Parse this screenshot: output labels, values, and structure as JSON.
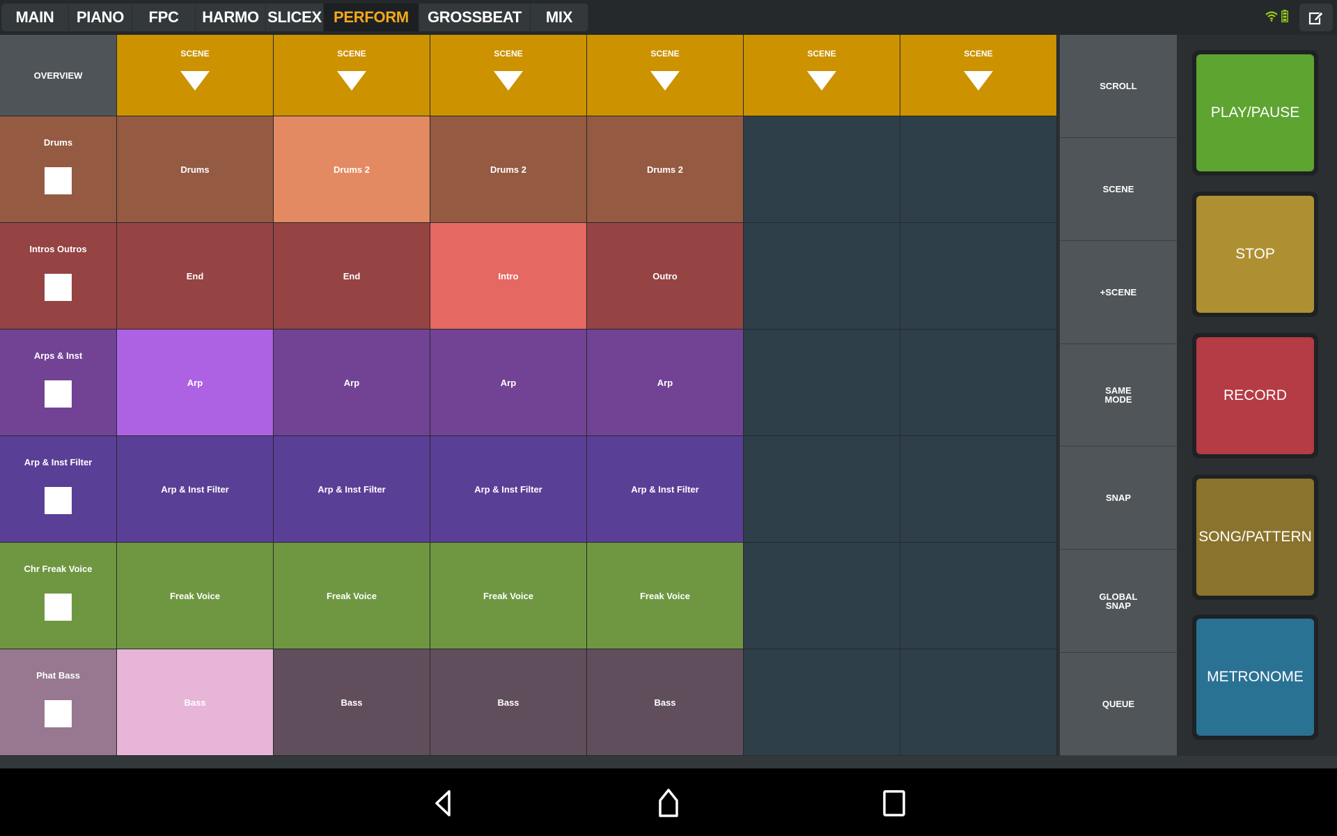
{
  "tabs": [
    {
      "label": "MAIN",
      "active": false
    },
    {
      "label": "PIANO",
      "active": false
    },
    {
      "label": "FPC",
      "active": false
    },
    {
      "label": "HARMO",
      "active": false
    },
    {
      "label": "SLICEX",
      "active": false
    },
    {
      "label": "PERFORM",
      "active": true
    },
    {
      "label": "GROSSBEAT",
      "active": false
    },
    {
      "label": "MIX",
      "active": false
    }
  ],
  "status": {
    "wifi_icon": "wifi-icon",
    "battery_icon": "battery-icon",
    "accent": "#9ccc1a"
  },
  "edit_icon": "edit-icon",
  "grid": {
    "overview_label": "OVERVIEW",
    "scene_label": "SCENE",
    "scene_count": 6,
    "tracks": [
      {
        "name": "Drums",
        "color": "#955a42",
        "active_color": "#e38a62",
        "clips": [
          {
            "label": "Drums",
            "active": false
          },
          {
            "label": "Drums 2",
            "active": true
          },
          {
            "label": "Drums 2",
            "active": false
          },
          {
            "label": "Drums 2",
            "active": false
          }
        ]
      },
      {
        "name": "Intros Outros",
        "color": "#954343",
        "active_color": "#e56862",
        "clips": [
          {
            "label": "End",
            "active": false
          },
          {
            "label": "End",
            "active": false
          },
          {
            "label": "Intro",
            "active": true
          },
          {
            "label": "Outro",
            "active": false
          }
        ]
      },
      {
        "name": "Arps & Inst",
        "color": "#724395",
        "active_color": "#ad62e3",
        "clips": [
          {
            "label": "Arp",
            "active": true
          },
          {
            "label": "Arp",
            "active": false
          },
          {
            "label": "Arp",
            "active": false
          },
          {
            "label": "Arp",
            "active": false
          }
        ]
      },
      {
        "name": "Arp & Inst Filter",
        "color": "#5a3f96",
        "active_color": "#7b5dd0",
        "clips": [
          {
            "label": "Arp & Inst Filter",
            "active": false
          },
          {
            "label": "Arp & Inst Filter",
            "active": false
          },
          {
            "label": "Arp & Inst Filter",
            "active": false
          },
          {
            "label": "Arp & Inst Filter",
            "active": false
          }
        ]
      },
      {
        "name": "Chr Freak Voice",
        "color": "#6f9741",
        "active_color": "#9ccc62",
        "clips": [
          {
            "label": "Freak Voice",
            "active": false
          },
          {
            "label": "Freak Voice",
            "active": false
          },
          {
            "label": "Freak Voice",
            "active": false
          },
          {
            "label": "Freak Voice",
            "active": false
          }
        ]
      },
      {
        "name": "Phat Bass",
        "color": "#614e5c",
        "header_color": "#977890",
        "active_color": "#e6b5d8",
        "clips": [
          {
            "label": "Bass",
            "active": true
          },
          {
            "label": "Bass",
            "active": false
          },
          {
            "label": "Bass",
            "active": false
          },
          {
            "label": "Bass",
            "active": false
          }
        ]
      }
    ],
    "empty_color": "#2f3f4a",
    "scene_color": "#cc9200"
  },
  "controls": [
    {
      "label": "SCROLL"
    },
    {
      "label": "SCENE"
    },
    {
      "label": "+SCENE"
    },
    {
      "label": "SAME\nMODE"
    },
    {
      "label": "SNAP"
    },
    {
      "label": "GLOBAL\nSNAP"
    },
    {
      "label": "QUEUE"
    }
  ],
  "transport": [
    {
      "label": "PLAY/PAUSE",
      "color": "#5da431",
      "name": "play-pause-button"
    },
    {
      "label": "STOP",
      "color": "#ae9033",
      "name": "stop-button"
    },
    {
      "label": "RECORD",
      "color": "#b53b44",
      "name": "record-button"
    },
    {
      "label": "SONG/PATTERN",
      "color": "#8a732c",
      "name": "song-pattern-button"
    },
    {
      "label": "METRONOME",
      "color": "#2a7294",
      "name": "metronome-button"
    }
  ],
  "navbar": {
    "back_icon": "back-icon",
    "home_icon": "home-icon",
    "recents_icon": "recents-icon"
  }
}
